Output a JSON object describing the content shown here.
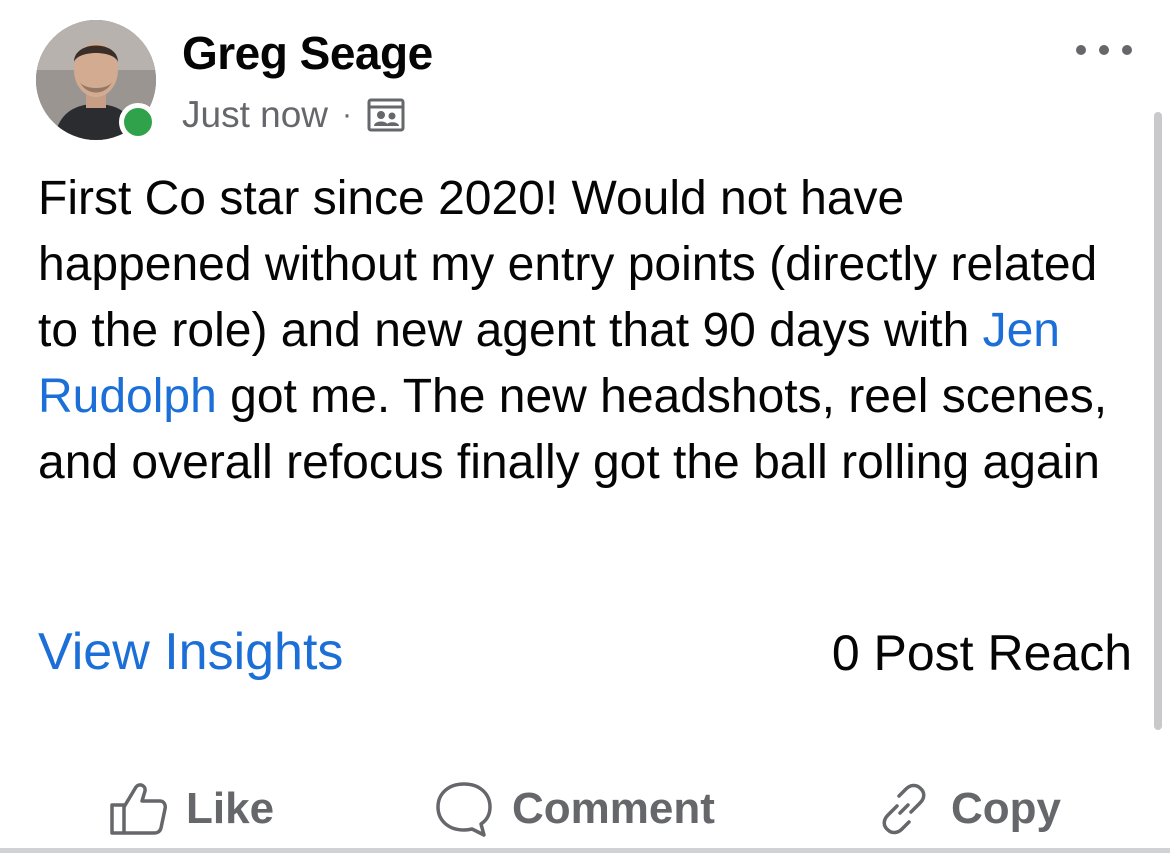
{
  "post": {
    "author": {
      "name": "Greg Seage",
      "online": true,
      "avatar_icon": "profile-photo"
    },
    "timestamp": "Just now",
    "separator": "·",
    "audience_icon": "photo-album-icon",
    "more_icon": "more-horizontal-icon",
    "text": {
      "part1": "First Co star since 2020! Would not have happened without my entry points (directly related to the role) and new agent that 90 days with ",
      "mention": "Jen Rudolph",
      "part2": " got me. The new headshots, reel scenes, and overall refocus finally got the ball rolling again"
    }
  },
  "insights": {
    "link_label": "View Insights",
    "reach_label": "0 Post Reach"
  },
  "actions": [
    {
      "label": "Like",
      "icon": "thumbs-up-icon"
    },
    {
      "label": "Comment",
      "icon": "comment-bubble-icon"
    },
    {
      "label": "Copy",
      "icon": "link-icon"
    }
  ],
  "colors": {
    "link_blue": "#1b6fd6",
    "secondary_text": "#65676b",
    "online_green": "#31a24c"
  }
}
